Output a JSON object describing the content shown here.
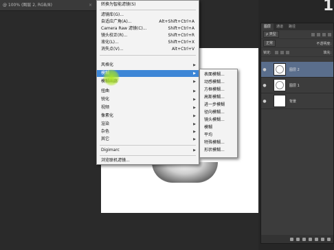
{
  "document": {
    "tab_title": "@ 100% (图层 2, RGB/8)",
    "tab_close": "×",
    "corner_digit": "1"
  },
  "filter_menu": {
    "items": [
      {
        "label": "转换为智能滤镜(S)",
        "shortcut": "",
        "has_submenu": false
      },
      {
        "label": "滤镜库(G)...",
        "shortcut": "",
        "has_submenu": false
      },
      {
        "label": "自适应广角(A)...",
        "shortcut": "Alt+Shift+Ctrl+A",
        "has_submenu": false
      },
      {
        "label": "Camera Raw 滤镜(C)...",
        "shortcut": "Shift+Ctrl+A",
        "has_submenu": false
      },
      {
        "label": "镜头校正(R)...",
        "shortcut": "Shift+Ctrl+R",
        "has_submenu": false
      },
      {
        "label": "液化(L)...",
        "shortcut": "Shift+Ctrl+X",
        "has_submenu": false
      },
      {
        "label": "消失点(V)...",
        "shortcut": "Alt+Ctrl+V",
        "has_submenu": false
      },
      {
        "label": "风格化",
        "shortcut": "",
        "has_submenu": true
      },
      {
        "label": "模糊",
        "shortcut": "",
        "has_submenu": true,
        "highlighted": true
      },
      {
        "label": "模糊画廊",
        "shortcut": "",
        "has_submenu": true
      },
      {
        "label": "扭曲",
        "shortcut": "",
        "has_submenu": true
      },
      {
        "label": "锐化",
        "shortcut": "",
        "has_submenu": true
      },
      {
        "label": "视频",
        "shortcut": "",
        "has_submenu": true
      },
      {
        "label": "像素化",
        "shortcut": "",
        "has_submenu": true
      },
      {
        "label": "渲染",
        "shortcut": "",
        "has_submenu": true
      },
      {
        "label": "杂色",
        "shortcut": "",
        "has_submenu": true
      },
      {
        "label": "其它",
        "shortcut": "",
        "has_submenu": true
      },
      {
        "label": "Digimarc",
        "shortcut": "",
        "has_submenu": true
      },
      {
        "label": "浏览联机滤镜...",
        "shortcut": "",
        "has_submenu": false
      }
    ],
    "arrow_glyph": "▶"
  },
  "blur_submenu": {
    "items": [
      "表面模糊...",
      "动感模糊...",
      "方框模糊...",
      "高斯模糊...",
      "进一步模糊",
      "径向模糊...",
      "镜头模糊...",
      "模糊",
      "平均",
      "特殊模糊...",
      "形状模糊..."
    ]
  },
  "layers_panel": {
    "tabs": [
      "图层",
      "通道",
      "路径"
    ],
    "kind_filter": "ρ 类型",
    "blend_mode": "正常",
    "opacity_label": "不透明度:",
    "lock_label": "锁定:",
    "fill_label": "填充:",
    "eye_glyph": "●",
    "layers": [
      {
        "name": "图层 2",
        "selected": true
      },
      {
        "name": "图层 1",
        "selected": false
      },
      {
        "name": "背景",
        "selected": false
      }
    ]
  },
  "colors": {
    "menu_highlight": "#3d86d6",
    "layer_selected": "#5a6e8c",
    "cursor_highlight": "#aae61e"
  }
}
